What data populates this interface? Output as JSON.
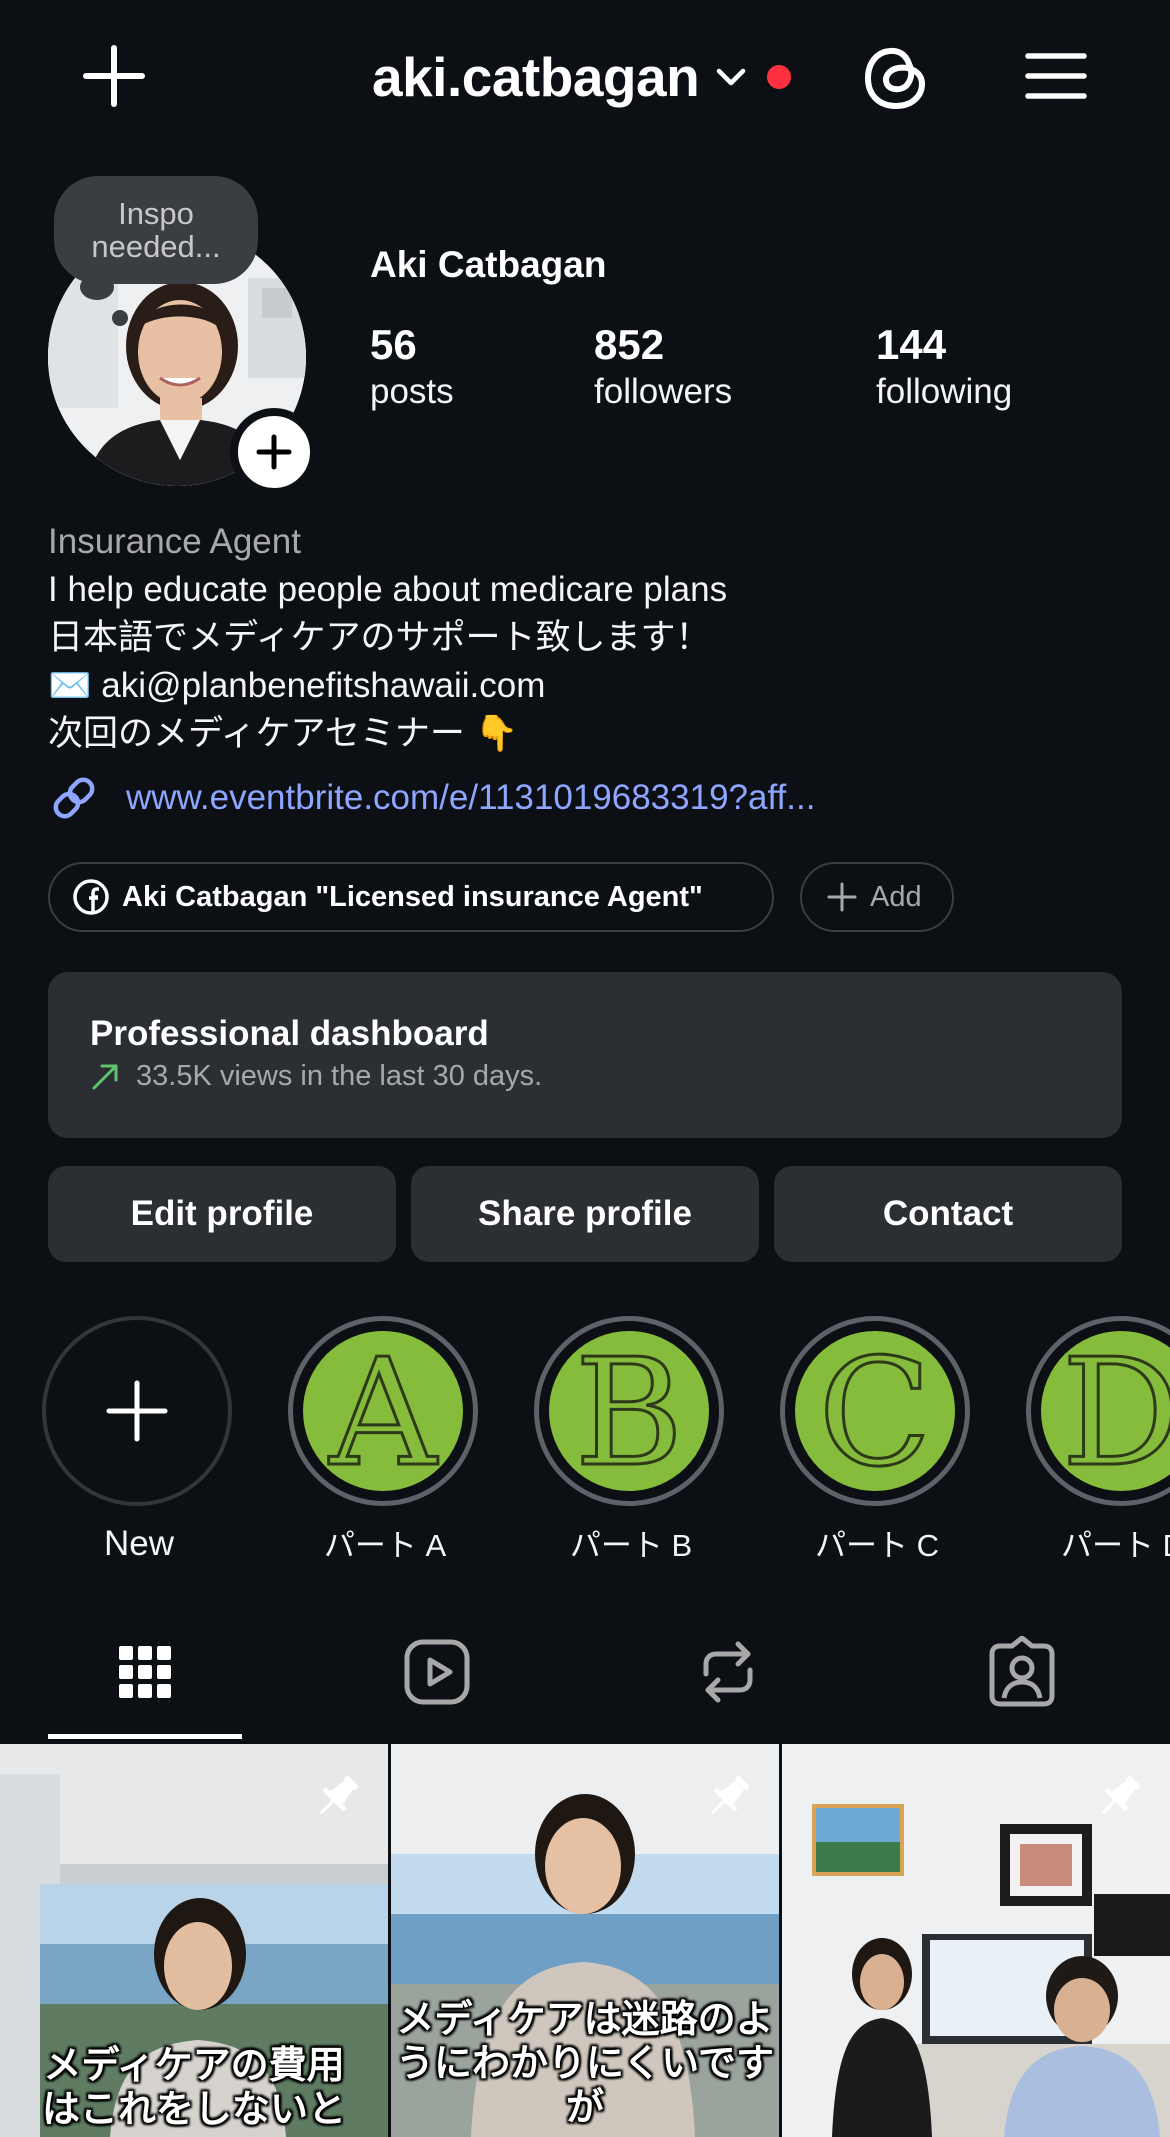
{
  "header": {
    "username": "aki.catbagan",
    "notification_color": "#ff3040"
  },
  "profile": {
    "note_line1": "Inspo",
    "note_line2": "needed...",
    "name": "Aki Catbagan",
    "stats": [
      {
        "value": "56",
        "label": "posts"
      },
      {
        "value": "852",
        "label": "followers"
      },
      {
        "value": "144",
        "label": "following"
      }
    ]
  },
  "bio": {
    "category": "Insurance Agent",
    "lines": [
      "I help educate people about medicare plans",
      "日本語でメディケアのサポート致します！",
      "✉️ aki@planbenefitshawaii.com",
      "次回のメディケアセミナー 👇"
    ],
    "link": "www.eventbrite.com/e/1131019683319?aff..."
  },
  "chips": {
    "facebook": "Aki Catbagan \"Licensed insurance Agent\"",
    "add": "Add"
  },
  "dashboard": {
    "title": "Professional dashboard",
    "subtitle": "33.5K views in the last 30 days."
  },
  "buttons": {
    "edit": "Edit profile",
    "share": "Share profile",
    "contact": "Contact"
  },
  "highlights": [
    {
      "label": "New",
      "icon": "plus-icon"
    },
    {
      "label": "パート A",
      "letter": "A"
    },
    {
      "label": "パート B",
      "letter": "B"
    },
    {
      "label": "パート C",
      "letter": "C"
    },
    {
      "label": "パート D",
      "letter": "D"
    }
  ],
  "tabs": [
    {
      "icon": "grid-icon",
      "active": true
    },
    {
      "icon": "reels-icon"
    },
    {
      "icon": "reposts-icon"
    },
    {
      "icon": "tagged-icon"
    }
  ],
  "posts": [
    {
      "caption_line1": "メディケアの費用",
      "caption_line2": "はこれをしないと",
      "pinned": true
    },
    {
      "caption_line1": "メディケアは迷路のよ",
      "caption_line2": "うにわかりにくいですが",
      "pinned": true
    },
    {
      "caption_line1": "",
      "caption_line2": "",
      "pinned": true
    }
  ],
  "colors": {
    "background": "#0c1014",
    "surface": "#2b2f33",
    "link": "#8ea6ff",
    "highlight_green": "#86bc3b",
    "trend_green": "#5fc46d"
  }
}
